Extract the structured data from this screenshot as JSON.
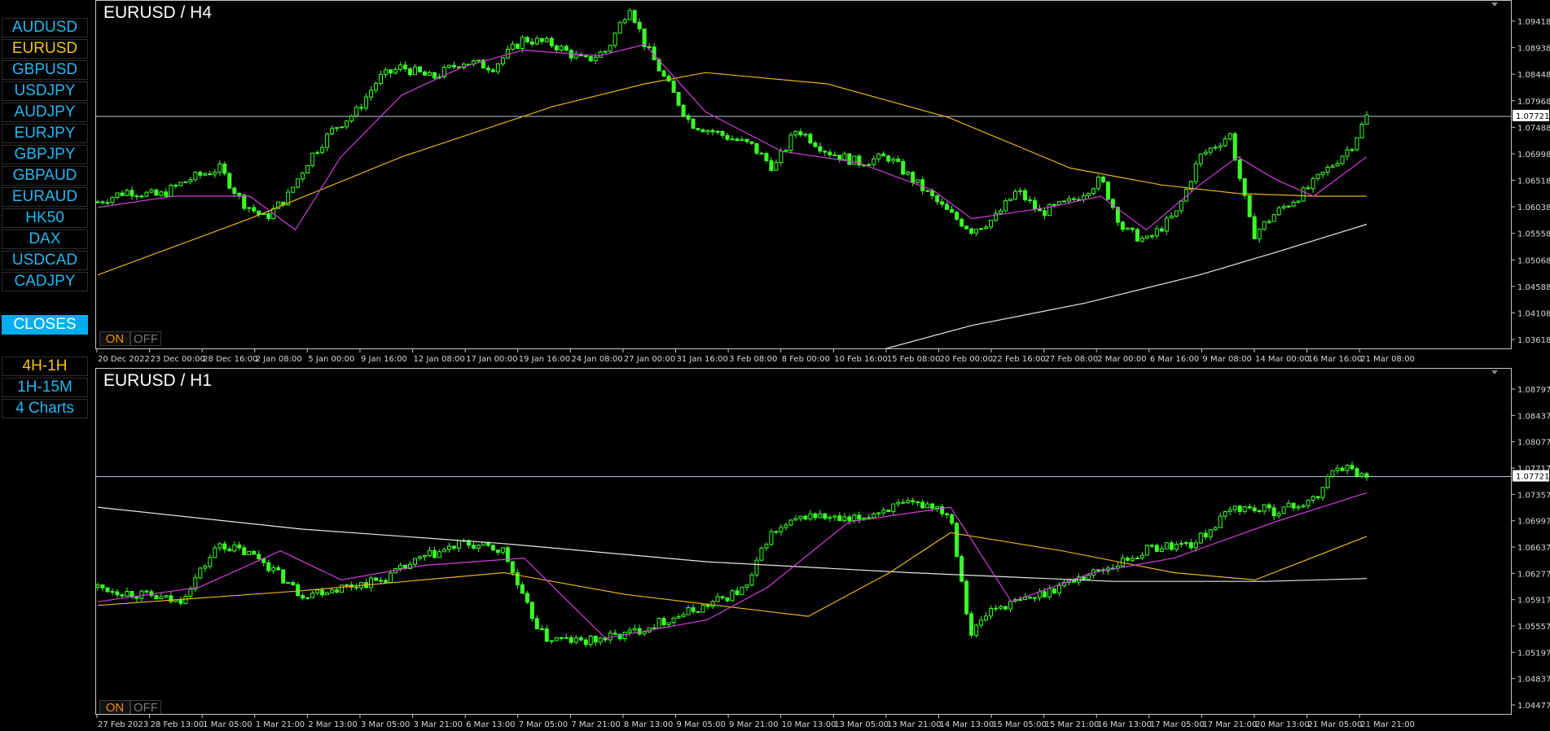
{
  "colors": {
    "background": "#000000",
    "candle": "#3cff28",
    "ma_fast": "#d63ce0",
    "ma_slow": "#e8b414",
    "ma_long": "#e8e8e8",
    "price_line": "#b4c8dc",
    "symbol_text": "#23b8f0",
    "symbol_active": "#f2c40f",
    "closes_bg": "#00aeef"
  },
  "sidebar": {
    "symbols": [
      {
        "label": "AUDUSD",
        "active": false
      },
      {
        "label": "EURUSD",
        "active": true
      },
      {
        "label": "GBPUSD",
        "active": false
      },
      {
        "label": "USDJPY",
        "active": false
      },
      {
        "label": "AUDJPY",
        "active": false
      },
      {
        "label": "EURJPY",
        "active": false
      },
      {
        "label": "GBPJPY",
        "active": false
      },
      {
        "label": "GBPAUD",
        "active": false
      },
      {
        "label": "EURAUD",
        "active": false
      },
      {
        "label": "HK50",
        "active": false
      },
      {
        "label": "DAX",
        "active": false
      },
      {
        "label": "USDCAD",
        "active": false
      },
      {
        "label": "CADJPY",
        "active": false
      }
    ],
    "closes_label": "CLOSES",
    "timeframe_buttons": [
      {
        "label": "4H-1H",
        "active": true
      },
      {
        "label": "1H-15M",
        "active": false
      },
      {
        "label": "4 Charts",
        "active": false
      }
    ]
  },
  "charts": [
    {
      "title": "EURUSD / H4",
      "current_price": "1.07721",
      "price_labels": [
        "1.09418",
        "1.08938",
        "1.08448",
        "1.07968",
        "1.07488",
        "1.06998",
        "1.06518",
        "1.06038",
        "1.05558",
        "1.05068",
        "1.04588",
        "1.04108",
        "1.03618"
      ],
      "time_labels": [
        "20 Dec 2022",
        "23 Dec 00:00",
        "28 Dec 16:00",
        "2 Jan 08:00",
        "5 Jan 00:00",
        "9 Jan 16:00",
        "12 Jan 08:00",
        "17 Jan 00:00",
        "19 Jan 16:00",
        "24 Jan 08:00",
        "27 Jan 00:00",
        "31 Jan 16:00",
        "3 Feb 08:00",
        "8 Feb 00:00",
        "10 Feb 16:00",
        "15 Feb 08:00",
        "20 Feb 00:00",
        "22 Feb 16:00",
        "27 Feb 08:00",
        "2 Mar 00:00",
        "6 Mar 16:00",
        "9 Mar 08:00",
        "14 Mar 00:00",
        "16 Mar 16:00",
        "21 Mar 08:00"
      ],
      "on_label": "ON",
      "off_label": "OFF"
    },
    {
      "title": "EURUSD / H1",
      "current_price": "1.07721",
      "price_labels": [
        "1.08797",
        "1.08437",
        "1.08077",
        "1.07717",
        "1.07357",
        "1.06997",
        "1.06637",
        "1.06277",
        "1.05917",
        "1.05557",
        "1.05197",
        "1.04837",
        "1.04477"
      ],
      "time_labels": [
        "27 Feb 2023",
        "28 Feb 13:00",
        "1 Mar 05:00",
        "1 Mar 21:00",
        "2 Mar 13:00",
        "3 Mar 05:00",
        "3 Mar 21:00",
        "6 Mar 13:00",
        "7 Mar 05:00",
        "7 Mar 21:00",
        "8 Mar 13:00",
        "9 Mar 05:00",
        "9 Mar 21:00",
        "10 Mar 13:00",
        "13 Mar 05:00",
        "13 Mar 21:00",
        "14 Mar 13:00",
        "15 Mar 05:00",
        "15 Mar 21:00",
        "16 Mar 13:00",
        "17 Mar 05:00",
        "17 Mar 21:00",
        "20 Mar 13:00",
        "21 Mar 05:00",
        "21 Mar 21:00"
      ],
      "on_label": "ON",
      "off_label": "OFF"
    }
  ],
  "chart_data": [
    {
      "type": "candlestick",
      "title": "EURUSD / H4",
      "ylim": [
        1.0362,
        1.0972
      ],
      "current_price": 1.07721,
      "close_path": [
        [
          0,
          1.062
        ],
        [
          4,
          1.064
        ],
        [
          8,
          1.063
        ],
        [
          12,
          1.066
        ],
        [
          16,
          1.068
        ],
        [
          19,
          1.062
        ],
        [
          22,
          1.059
        ],
        [
          25,
          1.063
        ],
        [
          28,
          1.07
        ],
        [
          31,
          1.075
        ],
        [
          34,
          1.078
        ],
        [
          37,
          1.084
        ],
        [
          40,
          1.086
        ],
        [
          44,
          1.084
        ],
        [
          48,
          1.087
        ],
        [
          52,
          1.086
        ],
        [
          56,
          1.091
        ],
        [
          60,
          1.09
        ],
        [
          64,
          1.087
        ],
        [
          67,
          1.089
        ],
        [
          70,
          1.097
        ],
        [
          72,
          1.09
        ],
        [
          75,
          1.083
        ],
        [
          78,
          1.076
        ],
        [
          82,
          1.074
        ],
        [
          86,
          1.072
        ],
        [
          89,
          1.068
        ],
        [
          92,
          1.075
        ],
        [
          96,
          1.071
        ],
        [
          100,
          1.069
        ],
        [
          104,
          1.07
        ],
        [
          108,
          1.065
        ],
        [
          112,
          1.06
        ],
        [
          115,
          1.057
        ],
        [
          118,
          1.059
        ],
        [
          121,
          1.064
        ],
        [
          124,
          1.06
        ],
        [
          128,
          1.062
        ],
        [
          132,
          1.066
        ],
        [
          135,
          1.057
        ],
        [
          138,
          1.055
        ],
        [
          142,
          1.06
        ],
        [
          145,
          1.07
        ],
        [
          149,
          1.074
        ],
        [
          152,
          1.056
        ],
        [
          155,
          1.06
        ],
        [
          159,
          1.064
        ],
        [
          162,
          1.068
        ],
        [
          165,
          1.072
        ],
        [
          167,
          1.0772
        ]
      ],
      "ma_fast": [
        [
          0,
          1.061
        ],
        [
          10,
          1.063
        ],
        [
          20,
          1.063
        ],
        [
          26,
          1.057
        ],
        [
          32,
          1.07
        ],
        [
          40,
          1.081
        ],
        [
          48,
          1.086
        ],
        [
          56,
          1.089
        ],
        [
          66,
          1.088
        ],
        [
          72,
          1.09
        ],
        [
          80,
          1.078
        ],
        [
          90,
          1.071
        ],
        [
          100,
          1.069
        ],
        [
          110,
          1.064
        ],
        [
          115,
          1.059
        ],
        [
          125,
          1.061
        ],
        [
          132,
          1.063
        ],
        [
          138,
          1.057
        ],
        [
          145,
          1.065
        ],
        [
          150,
          1.07
        ],
        [
          155,
          1.066
        ],
        [
          160,
          1.063
        ],
        [
          167,
          1.07
        ]
      ],
      "ma_slow": [
        [
          0,
          1.049
        ],
        [
          20,
          1.059
        ],
        [
          40,
          1.07
        ],
        [
          60,
          1.079
        ],
        [
          72,
          1.083
        ],
        [
          80,
          1.085
        ],
        [
          96,
          1.083
        ],
        [
          112,
          1.077
        ],
        [
          128,
          1.068
        ],
        [
          140,
          1.065
        ],
        [
          150,
          1.0635
        ],
        [
          160,
          1.063
        ],
        [
          167,
          1.063
        ]
      ],
      "ma_long": [
        [
          100,
          1.0345
        ],
        [
          115,
          1.04
        ],
        [
          130,
          1.044
        ],
        [
          145,
          1.049
        ],
        [
          155,
          1.053
        ],
        [
          167,
          1.058
        ]
      ]
    },
    {
      "type": "candlestick",
      "title": "EURUSD / H1",
      "ylim": [
        1.0448,
        1.0916
      ],
      "current_price": 1.07721,
      "close_path": [
        [
          0,
          1.062
        ],
        [
          8,
          1.061
        ],
        [
          16,
          1.06
        ],
        [
          24,
          1.068
        ],
        [
          32,
          1.066
        ],
        [
          40,
          1.061
        ],
        [
          48,
          1.062
        ],
        [
          56,
          1.063
        ],
        [
          64,
          1.066
        ],
        [
          72,
          1.068
        ],
        [
          80,
          1.067
        ],
        [
          84,
          1.06
        ],
        [
          88,
          1.055
        ],
        [
          96,
          1.0545
        ],
        [
          104,
          1.0555
        ],
        [
          112,
          1.0575
        ],
        [
          120,
          1.0595
        ],
        [
          128,
          1.062
        ],
        [
          132,
          1.069
        ],
        [
          140,
          1.072
        ],
        [
          148,
          1.071
        ],
        [
          156,
          1.073
        ],
        [
          164,
          1.0735
        ],
        [
          168,
          1.072
        ],
        [
          172,
          1.0555
        ],
        [
          176,
          1.059
        ],
        [
          184,
          1.0605
        ],
        [
          192,
          1.063
        ],
        [
          200,
          1.065
        ],
        [
          208,
          1.0675
        ],
        [
          216,
          1.068
        ],
        [
          224,
          1.073
        ],
        [
          232,
          1.0725
        ],
        [
          240,
          1.074
        ],
        [
          244,
          1.079
        ],
        [
          250,
          1.0772
        ]
      ],
      "ma_fast": [
        [
          0,
          1.06
        ],
        [
          20,
          1.062
        ],
        [
          36,
          1.067
        ],
        [
          48,
          1.063
        ],
        [
          64,
          1.065
        ],
        [
          84,
          1.066
        ],
        [
          100,
          1.055
        ],
        [
          120,
          1.0575
        ],
        [
          132,
          1.062
        ],
        [
          148,
          1.071
        ],
        [
          168,
          1.073
        ],
        [
          180,
          1.06
        ],
        [
          196,
          1.064
        ],
        [
          212,
          1.066
        ],
        [
          232,
          1.071
        ],
        [
          250,
          1.075
        ]
      ],
      "ma_slow": [
        [
          0,
          1.0595
        ],
        [
          40,
          1.0615
        ],
        [
          80,
          1.064
        ],
        [
          104,
          1.061
        ],
        [
          128,
          1.059
        ],
        [
          140,
          1.058
        ],
        [
          156,
          1.064
        ],
        [
          168,
          1.0695
        ],
        [
          190,
          1.067
        ],
        [
          212,
          1.064
        ],
        [
          228,
          1.063
        ],
        [
          250,
          1.069
        ]
      ],
      "ma_long": [
        [
          0,
          1.073
        ],
        [
          40,
          1.07
        ],
        [
          80,
          1.068
        ],
        [
          120,
          1.0655
        ],
        [
          160,
          1.064
        ],
        [
          200,
          1.0628
        ],
        [
          230,
          1.0628
        ],
        [
          250,
          1.0632
        ]
      ]
    }
  ]
}
